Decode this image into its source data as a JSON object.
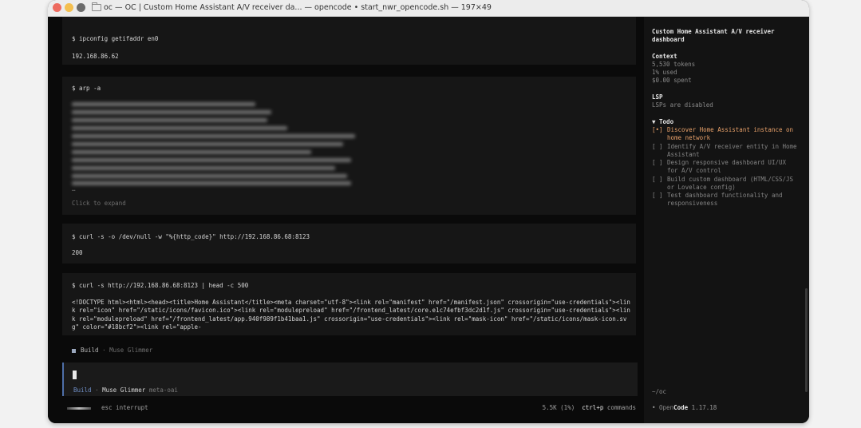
{
  "window": {
    "title": "oc — OC | Custom Home Assistant A/V receiver da... — opencode • start_nwr_opencode.sh — 197×49"
  },
  "blocks": {
    "ipconfig": {
      "command": "$ ipconfig getifaddr en0",
      "output": "192.168.86.62"
    },
    "arp": {
      "command": "$ arp -a",
      "ellipsis": "…",
      "expand_hint": "Click to expand"
    },
    "curl_code": {
      "command": "$ curl -s -o /dev/null -w \"%{http_code}\" http://192.168.86.68:8123",
      "output": "200"
    },
    "curl_head": {
      "command": "$ curl -s http://192.168.86.68:8123 | head -c 500",
      "output": "<!DOCTYPE html><html><head><title>Home Assistant</title><meta charset=\"utf-8\"><link rel=\"manifest\" href=\"/manifest.json\" crossorigin=\"use-credentials\"><link rel=\"icon\" href=\"/static/icons/favicon.ico\"><link rel=\"modulepreload\" href=\"/frontend_latest/core.e1c74efbf3dc2d1f.js\" crossorigin=\"use-credentials\"><link rel=\"modulepreload\" href=\"/frontend_latest/app.940f989f1b41baa1.js\" crossorigin=\"use-credentials\"><link rel=\"mask-icon\" href=\"/static/icons/mask-icon.svg\" color=\"#18bcf2\"><link rel=\"apple-"
    }
  },
  "build_status": {
    "mode": "Build",
    "separator": "·",
    "model": "Muse Glimmer"
  },
  "prompt": {
    "mode": "Build",
    "separator": "·",
    "model": "Muse Glimmer",
    "provider": "meta-oai"
  },
  "footer": {
    "interrupt": "esc interrupt",
    "tokens": "5.5K (1%)",
    "shortcut": "ctrl+p",
    "shortcut_label": "commands"
  },
  "sidebar": {
    "title": "Custom Home Assistant A/V receiver dashboard",
    "context_heading": "Context",
    "tokens": "5,530 tokens",
    "used": "1% used",
    "spent": "$0.00 spent",
    "lsp_heading": "LSP",
    "lsp_status": "LSPs are disabled",
    "todo_heading": "▼ Todo",
    "todos": [
      {
        "box": "[•]",
        "text": "Discover Home Assistant instance on home network"
      },
      {
        "box": "[ ]",
        "text": "Identify A/V receiver entity in Home Assistant"
      },
      {
        "box": "[ ]",
        "text": "Design responsive dashboard UI/UX for A/V control"
      },
      {
        "box": "[ ]",
        "text": "Build custom dashboard (HTML/CSS/JS or Lovelace config)"
      },
      {
        "box": "[ ]",
        "text": "Test dashboard functionality and responsiveness"
      }
    ],
    "path": "~/oc",
    "brand_bullet": "•",
    "brand_open": "Open",
    "brand_code": "Code",
    "version": "1.17.18"
  },
  "colors": {
    "accent": "#6f8fc7",
    "todo_active": "#e8a16a",
    "background": "#0a0a0a"
  }
}
